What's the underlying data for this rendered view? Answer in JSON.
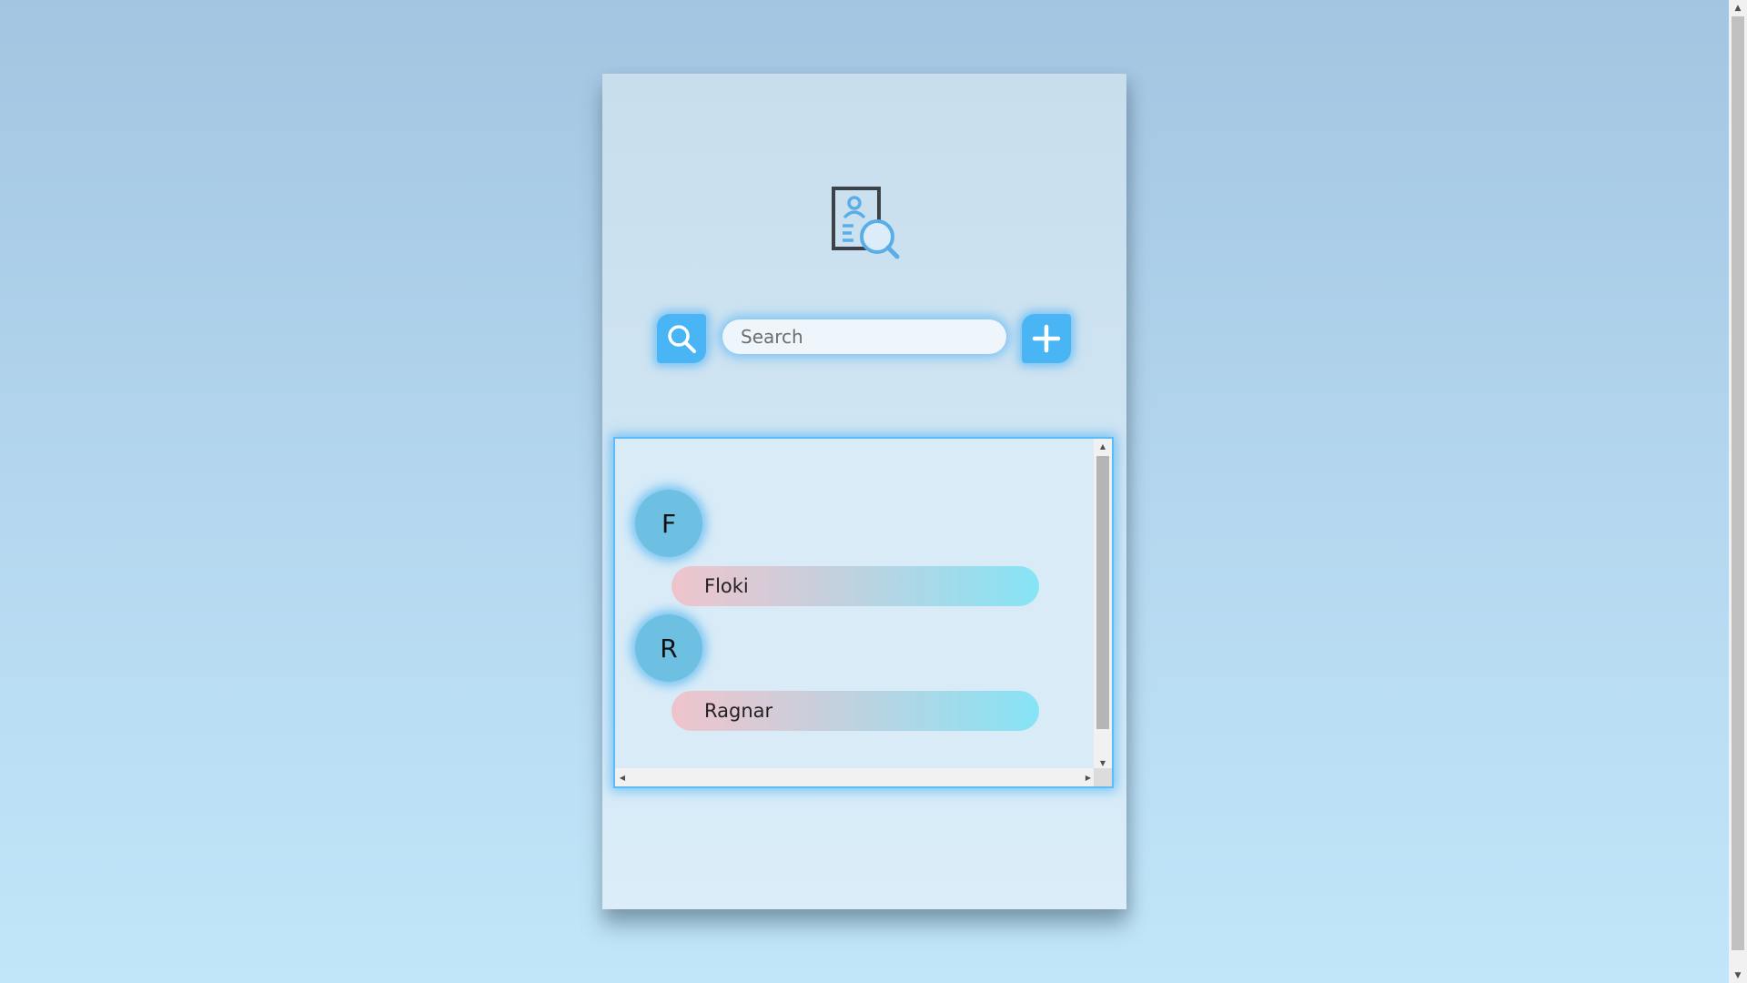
{
  "search": {
    "placeholder": "Search",
    "value": ""
  },
  "icons": {
    "logo": "contact-search-logo-icon",
    "search_button": "magnifier-icon",
    "add_button": "plus-icon"
  },
  "colors": {
    "accent": "#4ab5f5",
    "letter_badge": "#6ec0e3",
    "contact_gradient_start": "#efc4cc",
    "contact_gradient_end": "#86e4f5"
  },
  "contacts": {
    "groups": [
      {
        "letter": "F",
        "names": [
          "Floki"
        ]
      },
      {
        "letter": "R",
        "names": [
          "Ragnar"
        ]
      }
    ]
  }
}
